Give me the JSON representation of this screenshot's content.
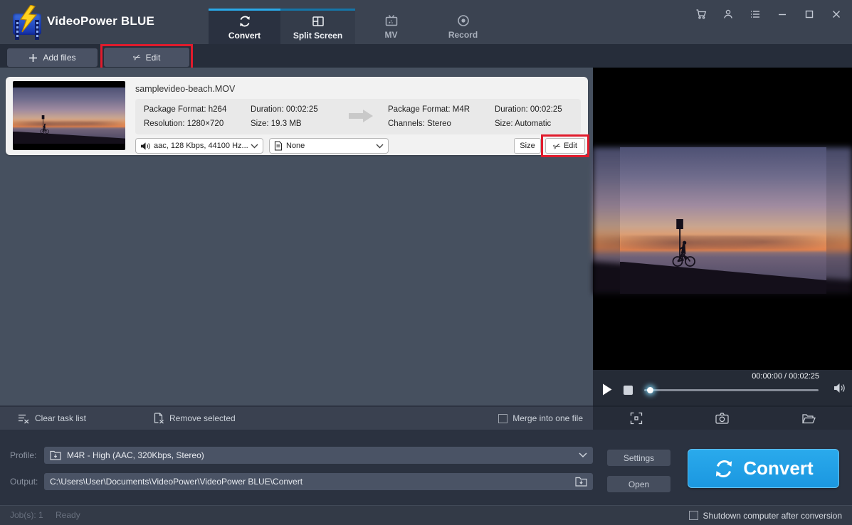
{
  "app": {
    "title": "VideoPower BLUE"
  },
  "colors": {
    "accent": "#1fa2e9",
    "annotation_red": "#e11b2c",
    "panel": "#46505f",
    "header": "#3b4351"
  },
  "tabs": [
    {
      "label": "Convert",
      "active": true
    },
    {
      "label": "Split Screen",
      "active": false
    },
    {
      "label": "MV",
      "active": false
    },
    {
      "label": "Record",
      "active": false
    }
  ],
  "toolbar": {
    "add_files_label": "Add files",
    "edit_label": "Edit"
  },
  "icons": {
    "edit_scissors": "✂"
  },
  "file_item": {
    "filename": "samplevideo-beach.MOV",
    "source": {
      "package": "Package Format: h264",
      "resolution": "Resolution: 1280×720",
      "duration": "Duration: 00:02:25",
      "size": "Size: 19.3 MB"
    },
    "target": {
      "package": "Package Format: M4R",
      "channels": "Channels: Stereo",
      "duration": "Duration: 00:02:25",
      "size": "Size: Automatic"
    },
    "audio_track": "aac, 128 Kbps, 44100 Hz...",
    "subtitle": "None",
    "size_button": "Size",
    "edit_button": "Edit"
  },
  "preview": {
    "timestamp": "00:00:00 / 00:02:25"
  },
  "task_bar": {
    "clear_task_list": "Clear task list",
    "remove_selected": "Remove selected",
    "merge_label": "Merge into one file"
  },
  "output_panel": {
    "profile_label": "Profile:",
    "profile_value": "M4R - High (AAC, 320Kbps, Stereo)",
    "output_label": "Output:",
    "output_path": "C:\\Users\\User\\Documents\\VideoPower\\VideoPower BLUE\\Convert",
    "settings_label": "Settings",
    "open_label": "Open",
    "convert_label": "Convert"
  },
  "status_bar": {
    "jobs": "Job(s): 1",
    "state": "Ready",
    "shutdown_label": "Shutdown computer after conversion"
  }
}
